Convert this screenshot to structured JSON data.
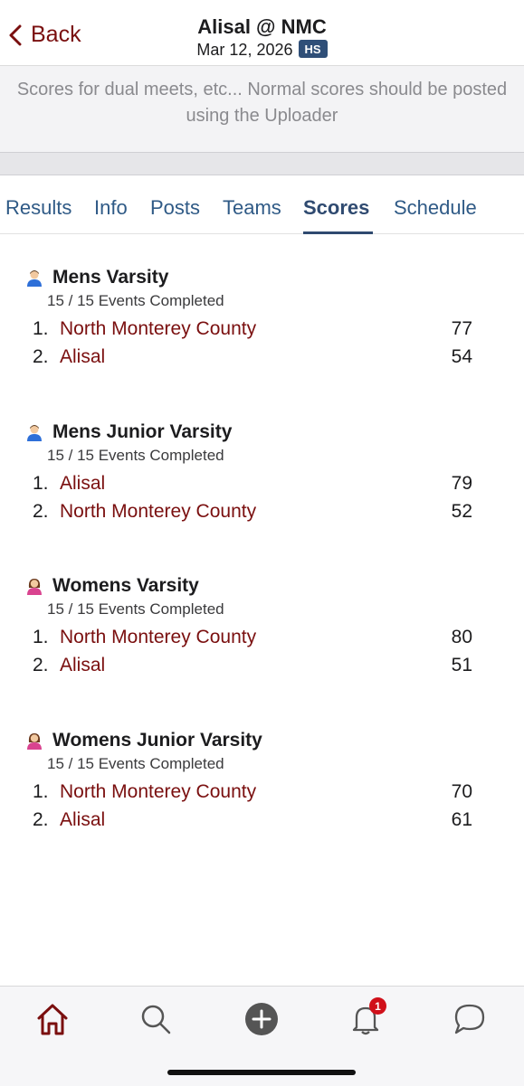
{
  "header": {
    "back_label": "Back",
    "title": "Alisal @ NMC",
    "date": "Mar 12, 2026",
    "badge": "HS"
  },
  "notice": "Scores for dual meets, etc... Normal scores should be posted using the Uploader",
  "tabs": [
    {
      "label": "Results"
    },
    {
      "label": "Info"
    },
    {
      "label": "Posts"
    },
    {
      "label": "Teams"
    },
    {
      "label": "Scores",
      "active": true
    },
    {
      "label": "Schedule"
    }
  ],
  "sections": [
    {
      "title": "Mens Varsity",
      "icon": "male-person-icon",
      "completed": "15 / 15  Events Completed",
      "rows": [
        {
          "rank": "1.",
          "team": "North Monterey County",
          "score": "77"
        },
        {
          "rank": "2.",
          "team": "Alisal",
          "score": "54"
        }
      ]
    },
    {
      "title": "Mens Junior Varsity",
      "icon": "male-person-icon",
      "completed": "15 / 15  Events Completed",
      "rows": [
        {
          "rank": "1.",
          "team": "Alisal",
          "score": "79"
        },
        {
          "rank": "2.",
          "team": "North Monterey County",
          "score": "52"
        }
      ]
    },
    {
      "title": "Womens Varsity",
      "icon": "female-person-icon",
      "completed": "15 / 15  Events Completed",
      "rows": [
        {
          "rank": "1.",
          "team": "North Monterey County",
          "score": "80"
        },
        {
          "rank": "2.",
          "team": "Alisal",
          "score": "51"
        }
      ]
    },
    {
      "title": "Womens Junior Varsity",
      "icon": "female-person-icon",
      "completed": "15 / 15  Events Completed",
      "rows": [
        {
          "rank": "1.",
          "team": "North Monterey County",
          "score": "70"
        },
        {
          "rank": "2.",
          "team": "Alisal",
          "score": "61"
        }
      ]
    }
  ],
  "bottom_nav": {
    "items": [
      "home-icon",
      "search-icon",
      "add-icon",
      "bell-icon",
      "chat-icon"
    ],
    "notification_count": "1"
  },
  "colors": {
    "accent": "#7a0f0f",
    "tab_active": "#2f4a70",
    "badge": "#2f4f78",
    "notification": "#d0101a"
  }
}
